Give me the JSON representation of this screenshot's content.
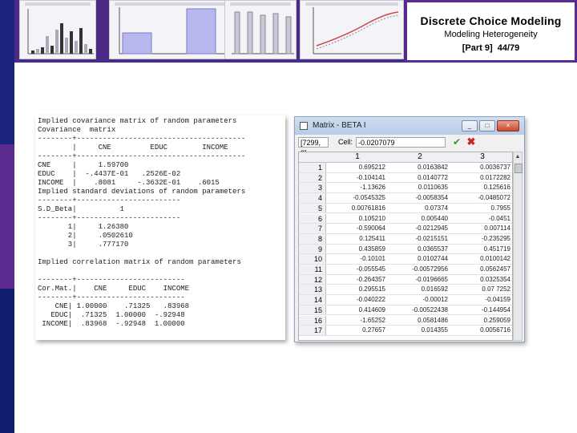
{
  "header": {
    "title": "Discrete Choice Modeling",
    "subtitle": "Modeling Heterogeneity",
    "part": "[Part 9]",
    "page": "44/79"
  },
  "output_text": "Implied covariance matrix of random parameters\nCovariance  matrix\n--------+---------------------------------------\n        |     CNE         EDUC        INCOME\n--------+---------------------------------------\nCNE     |     1.59700\nEDUC    |  -.4437E-01   .2526E-02\nINCOME  |    .8081     -.3632E-01    .6015\nImplied standard deviations of random parameters\n--------+------------------------\nS.D_Beta|          1\n--------+------------------------\n       1|     1.26380\n       2|     .0502610\n       3|     .777170\n\nImplied correlation matrix of random parameters\n\n--------+-------------------------\nCor.Mat.|    CNE     EDUC    INCOME\n--------+-------------------------\n    CNE| 1.00000    .71325   .83968\n   EDUC|  .71325  1.00000  -.92948\n INCOME|  .83968  -.92948  1.00000",
  "matrix_window": {
    "title": "Matrix - BETA I",
    "minimize": "_",
    "maximize": "□",
    "close": "×",
    "cell_ref": "[7299, 3]",
    "cell_label": "Cell:",
    "cell_value": "-0.0207079",
    "ok_glyph": "✔",
    "cancel_glyph": "✖",
    "columns": [
      "1",
      "2",
      "3"
    ],
    "rows": [
      {
        "n": "1",
        "v": [
          "0.695212",
          "0.0163842",
          "0.0036737"
        ]
      },
      {
        "n": "2",
        "v": [
          "-0.104141",
          "0.0140772",
          "0.0172282"
        ]
      },
      {
        "n": "3",
        "v": [
          "-1.13626",
          "0.0110635",
          "0.125616"
        ]
      },
      {
        "n": "4",
        "v": [
          "-0.0545325",
          "-0.0058354",
          "-0.0485072"
        ]
      },
      {
        "n": "5",
        "v": [
          "0.00761816",
          "0.07374",
          "0.7955"
        ]
      },
      {
        "n": "6",
        "v": [
          "0.105210",
          "0.005440",
          "-0.0451"
        ]
      },
      {
        "n": "7",
        "v": [
          "-0.590064",
          "-0.0212945",
          "0.007114"
        ]
      },
      {
        "n": "8",
        "v": [
          "0.125411",
          "-0.0215151",
          "-0.235295"
        ]
      },
      {
        "n": "9",
        "v": [
          "0.435859",
          "0.0365537",
          "0.451719"
        ]
      },
      {
        "n": "10",
        "v": [
          "-0.10101",
          "0.0102744",
          "0.0100142"
        ]
      },
      {
        "n": "11",
        "v": [
          "-0.055545",
          "-0.00572956",
          "0.0562457"
        ]
      },
      {
        "n": "12",
        "v": [
          "-0.264357",
          "-0.0196665",
          "0.0325354"
        ]
      },
      {
        "n": "13",
        "v": [
          "0.295515",
          "0.016592",
          "0.07 7252"
        ]
      },
      {
        "n": "14",
        "v": [
          "-0.040222",
          "-0.00012",
          "-0.04159"
        ]
      },
      {
        "n": "15",
        "v": [
          "0.414609",
          "-0.00522438",
          "-0.144954"
        ]
      },
      {
        "n": "16",
        "v": [
          "-1.65252",
          "0.0581486",
          "0.259059"
        ]
      },
      {
        "n": "17",
        "v": [
          "0.27657",
          "0.014355",
          "0.0056716"
        ]
      }
    ]
  }
}
